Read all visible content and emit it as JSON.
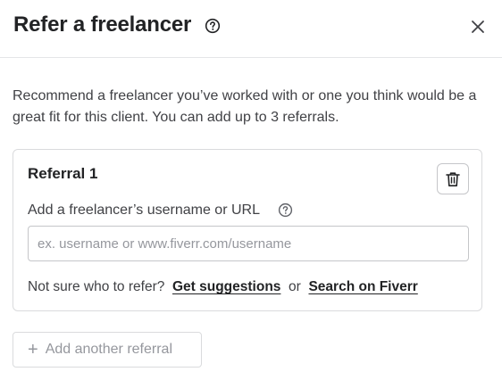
{
  "header": {
    "title": "Refer a freelancer",
    "help_icon": "question-circle-icon",
    "close_icon": "close-icon"
  },
  "description": "Recommend a freelancer you’ve worked with or one you think would be a great fit for this client. You can add up to 3 referrals.",
  "referral": {
    "title": "Referral 1",
    "delete_icon": "trash-icon",
    "field_label": "Add a freelancer’s username or URL",
    "field_help_icon": "question-circle-icon",
    "input_value": "",
    "input_placeholder": "ex. username or www.fiverr.com/username",
    "hint_prefix": "Not sure who to refer?",
    "get_suggestions_label": "Get suggestions",
    "or_text": "or",
    "search_label": "Search on Fiverr"
  },
  "add_button": {
    "icon": "plus-icon",
    "label": "Add another referral"
  }
}
